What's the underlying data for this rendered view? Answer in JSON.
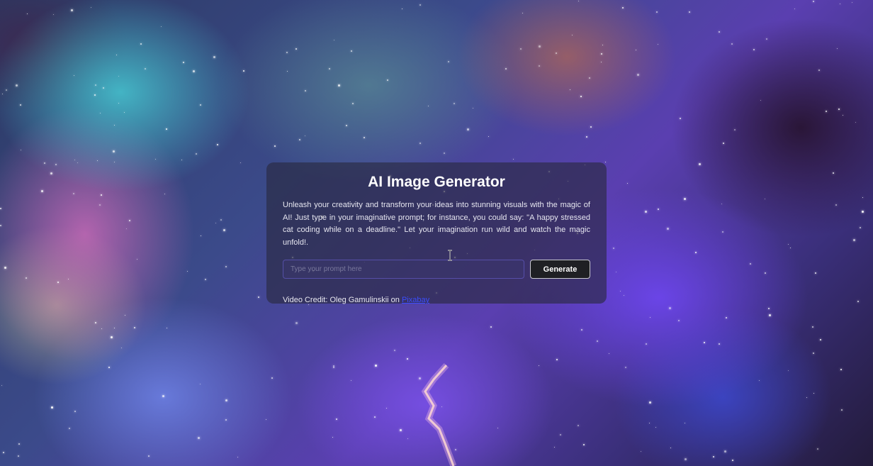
{
  "card": {
    "title": "AI Image Generator",
    "description": "Unleash your creativity and transform your ideas into stunning visuals with the magic of AI! Just type in your imaginative prompt; for instance, you could say: \"A happy stressed cat coding while on a deadline.\" Let your imagination run wild and watch the magic unfold!.",
    "prompt_placeholder": "Type your prompt here",
    "prompt_value": "",
    "generate_label": "Generate",
    "credit_prefix": "Video Credit: Oleg Gamulinskii on ",
    "credit_link": "Pixabay"
  },
  "colors": {
    "card_bg": "#28283e",
    "button_bg": "#1f2024",
    "link": "#3b4dff"
  },
  "icons": {
    "cursor": "text-cursor-icon"
  }
}
